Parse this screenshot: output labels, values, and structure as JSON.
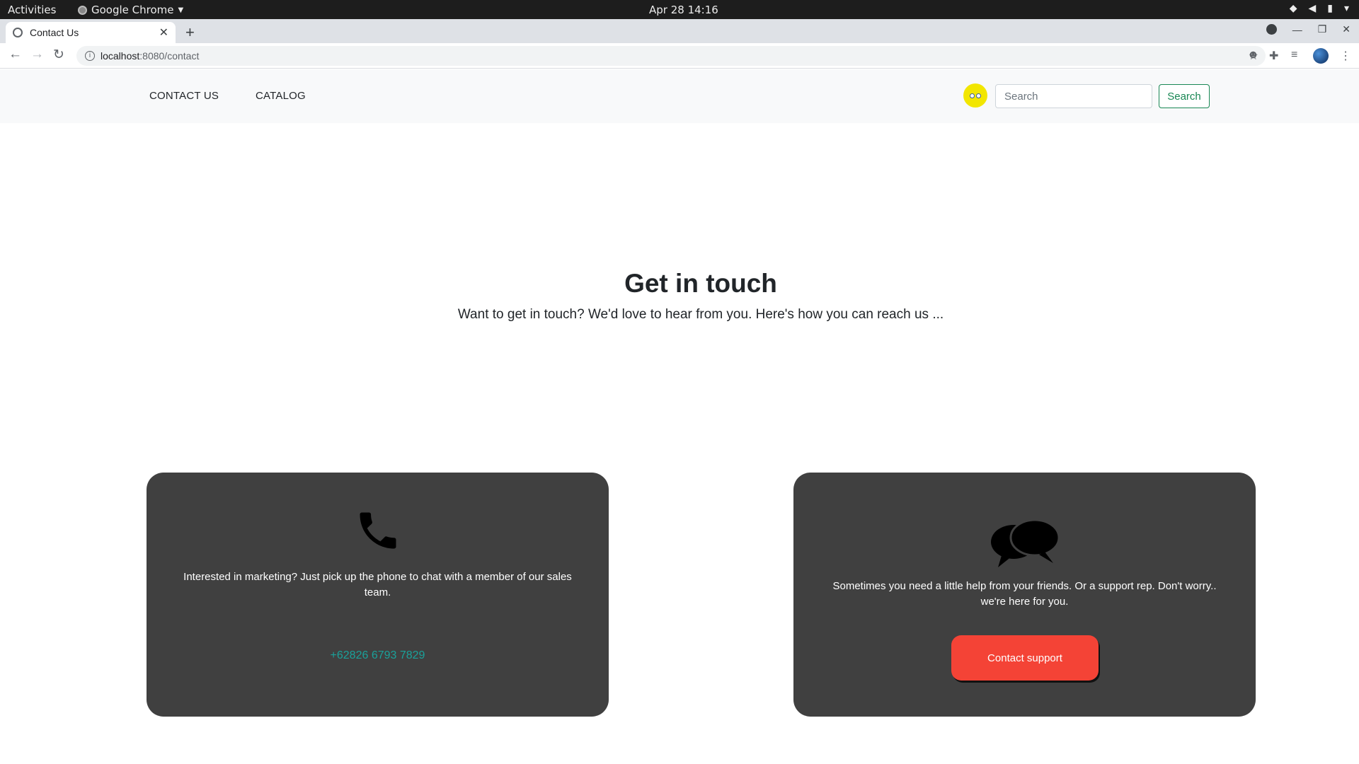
{
  "os_bar": {
    "activities": "Activities",
    "app_name": "Google Chrome",
    "clock": "Apr 28  14:16"
  },
  "browser": {
    "tab_title": "Contact Us",
    "url_host": "localhost",
    "url_path": ":8080/contact"
  },
  "navbar": {
    "links": [
      "CONTACT US",
      "CATALOG"
    ],
    "search_placeholder": "Search",
    "search_button": "Search"
  },
  "hero": {
    "title": "Get in touch",
    "subtitle": "Want to get in touch? We'd love to hear from you. Here's how you can reach us ..."
  },
  "cards": {
    "sales": {
      "icon": "phone-icon",
      "text": "Interested in marketing? Just pick up the phone to chat with a member of our sales team.",
      "phone": "+62826 6793 7829"
    },
    "support": {
      "icon": "chat-bubbles-icon",
      "text": "Sometimes you need a little help from your friends. Or a support rep. Don't worry.. we're here for you.",
      "button": "Contact support"
    }
  },
  "colors": {
    "card_bg": "#404040",
    "phone_link": "#1aa19a",
    "support_button": "#f44336",
    "search_button": "#198754",
    "avatar": "#f2e600"
  }
}
